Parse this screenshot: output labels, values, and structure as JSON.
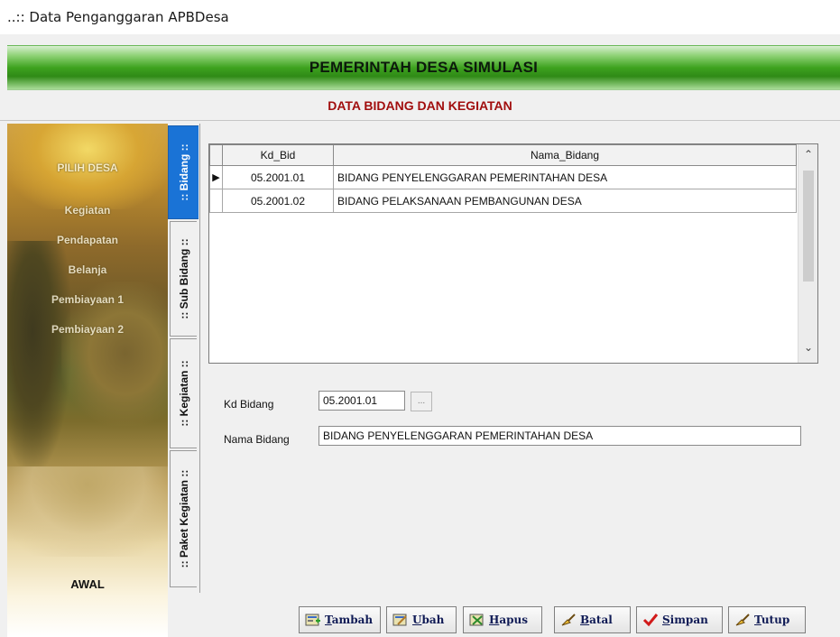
{
  "window": {
    "title": "..:: Data Penganggaran APBDesa"
  },
  "header": {
    "title": "PEMERINTAH DESA SIMULASI"
  },
  "subheader": {
    "title": "DATA BIDANG DAN KEGIATAN"
  },
  "sidebar": {
    "items": [
      {
        "label": "PILIH DESA"
      },
      {
        "label": "Kegiatan"
      },
      {
        "label": "Pendapatan"
      },
      {
        "label": "Belanja"
      },
      {
        "label": "Pembiayaan 1"
      },
      {
        "label": "Pembiayaan 2"
      }
    ],
    "bottom_label": "AWAL"
  },
  "tabs": [
    {
      "label": ":: Bidang ::",
      "active": true
    },
    {
      "label": ":: Sub Bidang ::",
      "active": false
    },
    {
      "label": ":: Kegiatan ::",
      "active": false
    },
    {
      "label": ":: Paket Kegiatan ::",
      "active": false
    }
  ],
  "grid": {
    "columns": [
      "Kd_Bid",
      "Nama_Bidang"
    ],
    "rows": [
      {
        "kd": "05.2001.01",
        "nama": "BIDANG PENYELENGGARAN PEMERINTAHAN DESA",
        "selected": true
      },
      {
        "kd": "05.2001.02",
        "nama": "BIDANG PELAKSANAAN PEMBANGUNAN DESA",
        "selected": false
      }
    ]
  },
  "form": {
    "kd_label": "Kd Bidang",
    "kd_value": "05.2001.01",
    "lookup_label": "...",
    "nama_label": "Nama Bidang",
    "nama_value": "BIDANG PENYELENGGARAN PEMERINTAHAN DESA"
  },
  "buttons": {
    "tambah": {
      "u": "T",
      "rest": "ambah"
    },
    "ubah": {
      "u": "U",
      "rest": "bah"
    },
    "hapus": {
      "u": "H",
      "rest": "apus"
    },
    "batal": {
      "u": "B",
      "rest": "atal"
    },
    "simpan": {
      "u": "S",
      "rest": "impan"
    },
    "tutup": {
      "u": "T",
      "rest": "utup"
    }
  },
  "colors": {
    "header_green": "#3ea21f",
    "subheader_red": "#a10e0e",
    "active_tab": "#1a73d6"
  }
}
